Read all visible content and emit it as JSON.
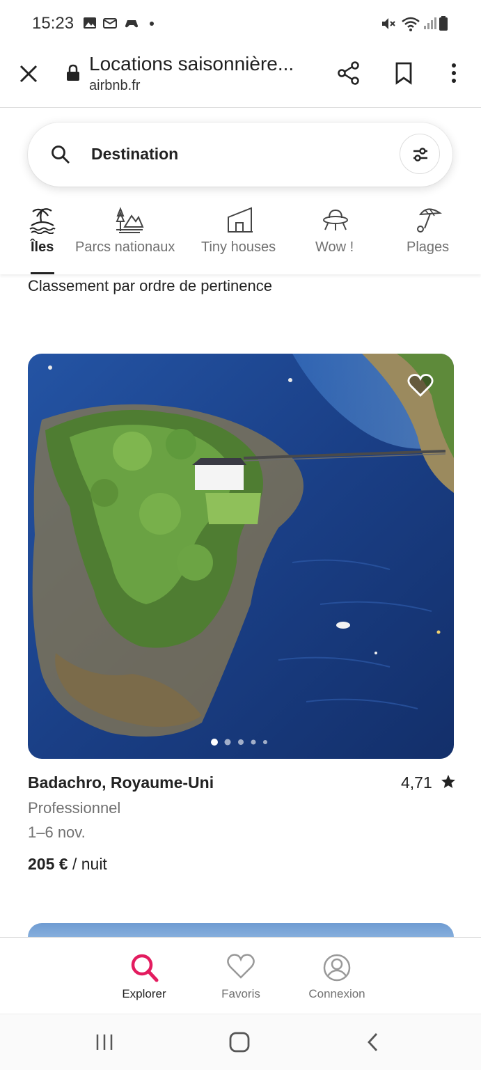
{
  "status_bar": {
    "time": "15:23"
  },
  "browser": {
    "title": "Locations saisonnière...",
    "domain": "airbnb.fr"
  },
  "search": {
    "label": "Destination"
  },
  "categories": [
    {
      "label": "Îles",
      "icon": "island-icon",
      "active": true
    },
    {
      "label": "Parcs nationaux",
      "icon": "national-park-icon",
      "active": false
    },
    {
      "label": "Tiny houses",
      "icon": "tiny-house-icon",
      "active": false
    },
    {
      "label": "Wow !",
      "icon": "ufo-icon",
      "active": false
    },
    {
      "label": "Plages",
      "icon": "beach-umbrella-icon",
      "active": false
    }
  ],
  "sort_text": "Classement par ordre de pertinence",
  "listing": {
    "title": "Badachro, Royaume-Uni",
    "rating": "4,71",
    "host_type": "Professionnel",
    "dates": "1–6 nov.",
    "price": "205 €",
    "price_unit": "/ nuit",
    "photo_count": 5,
    "current_photo": 1
  },
  "bottom_nav": [
    {
      "label": "Explorer",
      "icon": "search-icon",
      "active": true
    },
    {
      "label": "Favoris",
      "icon": "heart-icon",
      "active": false
    },
    {
      "label": "Connexion",
      "icon": "user-circle-icon",
      "active": false
    }
  ],
  "colors": {
    "brand": "#e31c5f",
    "text": "#222222",
    "muted": "#717171"
  }
}
